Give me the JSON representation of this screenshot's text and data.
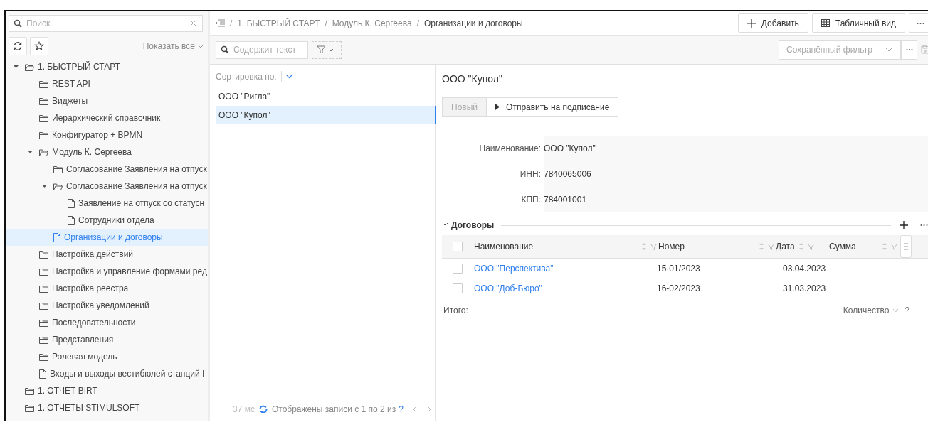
{
  "sidebar": {
    "search": {
      "placeholder": "Поиск"
    },
    "show_all": "Показать все",
    "tree": [
      {
        "label": "1. БЫСТРЫЙ СТАРТ",
        "kind": "folder",
        "expanded": true,
        "selected": false,
        "children": [
          {
            "label": "REST API",
            "kind": "folder",
            "expanded": false,
            "selected": false
          },
          {
            "label": "Виджеты",
            "kind": "folder",
            "expanded": false,
            "selected": false
          },
          {
            "label": "Иерархический справочник",
            "kind": "folder",
            "expanded": false,
            "selected": false
          },
          {
            "label": "Конфигуратор + BPMN",
            "kind": "folder",
            "expanded": false,
            "selected": false
          },
          {
            "label": "Модуль К. Сергеева",
            "kind": "folder",
            "expanded": true,
            "selected": false,
            "children": [
              {
                "label": "Согласование Заявления на отпуск",
                "kind": "folder",
                "expanded": false,
                "selected": false
              },
              {
                "label": "Согласование Заявления на отпуск",
                "kind": "folder",
                "expanded": true,
                "selected": false,
                "children": [
                  {
                    "label": "Заявление на отпуск со статусн",
                    "kind": "page",
                    "expanded": false,
                    "selected": false
                  },
                  {
                    "label": "Сотрудники отдела",
                    "kind": "page",
                    "expanded": false,
                    "selected": false
                  }
                ]
              },
              {
                "label": "Организации и договоры",
                "kind": "page",
                "expanded": false,
                "selected": true
              }
            ]
          },
          {
            "label": "Настройка действий",
            "kind": "folder",
            "expanded": false,
            "selected": false
          },
          {
            "label": "Настройка и управление формами ред",
            "kind": "folder",
            "expanded": false,
            "selected": false
          },
          {
            "label": "Настройка реестра",
            "kind": "folder",
            "expanded": false,
            "selected": false
          },
          {
            "label": "Настройка уведомлений",
            "kind": "folder",
            "expanded": false,
            "selected": false
          },
          {
            "label": "Последовательности",
            "kind": "folder",
            "expanded": false,
            "selected": false
          },
          {
            "label": "Представления",
            "kind": "folder",
            "expanded": false,
            "selected": false
          },
          {
            "label": "Ролевая модель",
            "kind": "folder",
            "expanded": false,
            "selected": false
          },
          {
            "label": "Входы и выходы вестибюлей станций I",
            "kind": "page",
            "expanded": false,
            "selected": false
          }
        ]
      },
      {
        "label": "1. ОТЧЕТ BIRT",
        "kind": "folder",
        "expanded": false,
        "selected": false
      },
      {
        "label": "1. ОТЧЕТЫ STIMULSOFT",
        "kind": "folder",
        "expanded": false,
        "selected": false
      }
    ]
  },
  "breadcrumb": [
    {
      "separator": "/",
      "label": "1. БЫСТРЫЙ СТАРТ"
    },
    {
      "separator": "/",
      "label": "Модуль К. Сергеева"
    },
    {
      "separator": "/",
      "label": "Организации и договоры"
    }
  ],
  "header_buttons": [
    {
      "kind": "add",
      "label": "Добавить"
    },
    {
      "kind": "table",
      "label": "Табличный вид"
    },
    {
      "kind": "more"
    }
  ],
  "filter_bar": {
    "search_placeholder": "Содержит текст",
    "saved_filter_placeholder": "Сохранённый фильтр"
  },
  "list": {
    "sort_label": "Сортировка по:",
    "items": [
      {
        "label": "ООО \"Ригла\"",
        "selected": false
      },
      {
        "label": "ООО \"Купол\"",
        "selected": true
      }
    ],
    "footer": {
      "time": "37 мс",
      "status": "Отображены записи с 1 по 2 из",
      "total": "?"
    }
  },
  "detail": {
    "title": "ООО \"Купол\"",
    "actions": [
      {
        "kind": "plain",
        "label": "Новый",
        "disabled": true
      },
      {
        "kind": "send",
        "label": "Отправить на подписание",
        "disabled": false
      }
    ],
    "fields": [
      {
        "label": "Наименование:",
        "value": "ООО \"Купол\""
      },
      {
        "label": "ИНН:",
        "value": "7840065006"
      },
      {
        "label": "КПП:",
        "value": "784001001"
      }
    ],
    "contracts": {
      "title": "Договоры",
      "expanded": true,
      "all_checked": false,
      "columns": [
        "Наименование",
        "Номер",
        "Дата",
        "Сумма"
      ],
      "rows": [
        {
          "checked": false,
          "cells": [
            "ООО \"Перспектива\"",
            "15-01/2023",
            "03.04.2023"
          ]
        },
        {
          "checked": false,
          "cells": [
            "ООО \"Доб-Бюро\"",
            "16-02/2023",
            "31.03.2023"
          ]
        }
      ],
      "totals_label": "Итого:",
      "aggregate": "Количество",
      "aggregate_value": "?"
    }
  }
}
